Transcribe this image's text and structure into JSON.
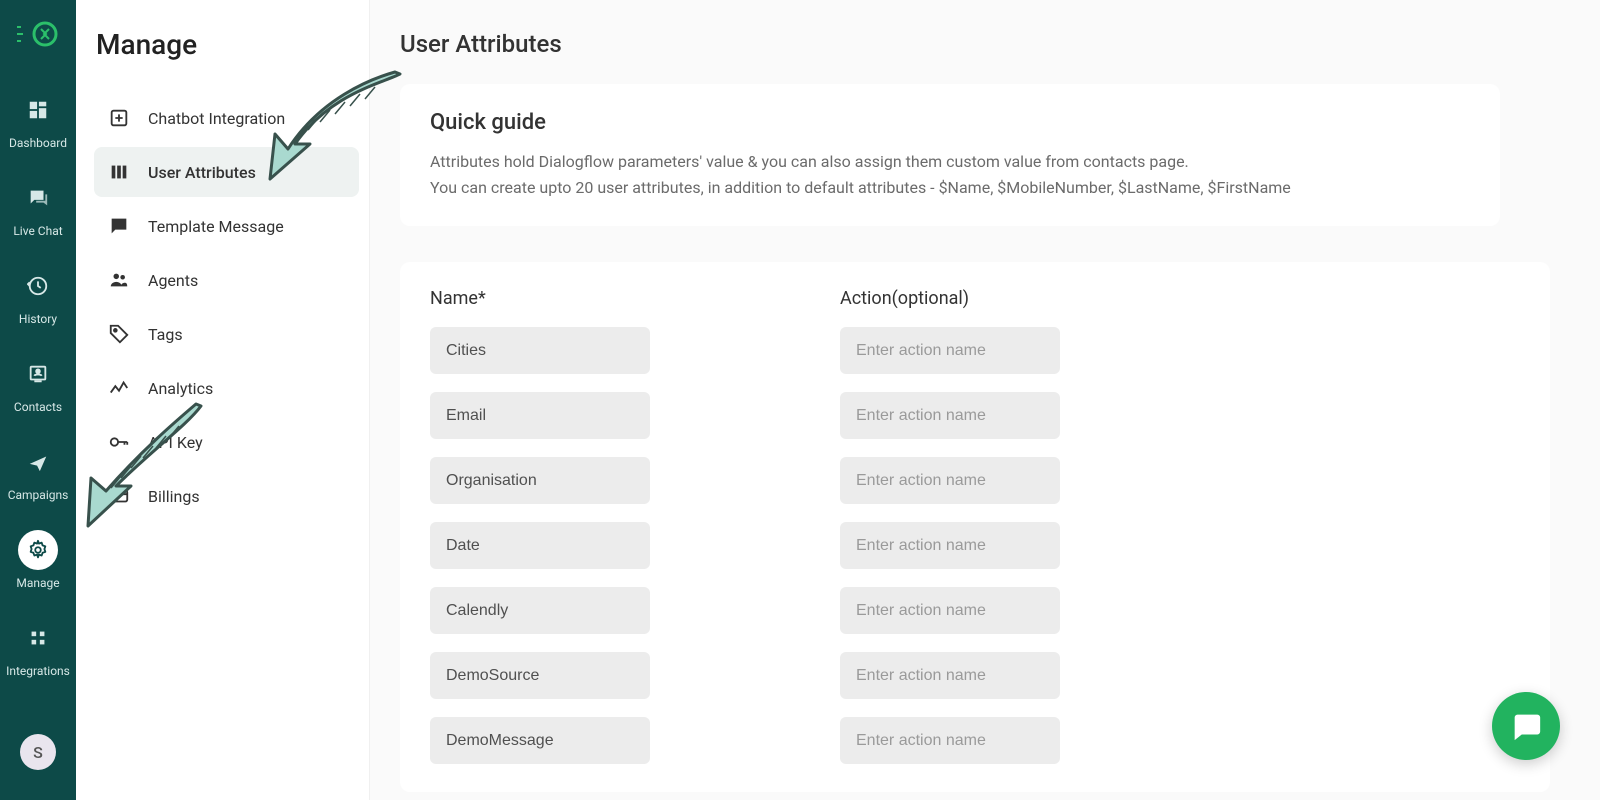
{
  "rail": {
    "items": [
      {
        "id": "dashboard",
        "label": "Dashboard"
      },
      {
        "id": "livechat",
        "label": "Live Chat"
      },
      {
        "id": "history",
        "label": "History"
      },
      {
        "id": "contacts",
        "label": "Contacts"
      },
      {
        "id": "campaigns",
        "label": "Campaigns"
      },
      {
        "id": "manage",
        "label": "Manage"
      },
      {
        "id": "integrations",
        "label": "Integrations"
      }
    ],
    "avatar_initial": "S"
  },
  "menu": {
    "title": "Manage",
    "items": [
      {
        "id": "chatbot-integration",
        "label": "Chatbot Integration"
      },
      {
        "id": "user-attributes",
        "label": "User Attributes"
      },
      {
        "id": "template-message",
        "label": "Template Message"
      },
      {
        "id": "agents",
        "label": "Agents"
      },
      {
        "id": "tags",
        "label": "Tags"
      },
      {
        "id": "analytics",
        "label": "Analytics"
      },
      {
        "id": "api-key",
        "label": "API Key"
      },
      {
        "id": "billings",
        "label": "Billings"
      }
    ]
  },
  "page": {
    "title": "User Attributes",
    "guide_title": "Quick guide",
    "guide_line1": "Attributes hold Dialogflow parameters' value & you can also assign them custom value from contacts page.",
    "guide_line2": "You can create upto 20 user attributes, in addition to default attributes - $Name, $MobileNumber, $LastName, $FirstName",
    "name_header": "Name*",
    "action_header": "Action(optional)",
    "action_placeholder": "Enter action name",
    "rows": [
      {
        "name": "Cities"
      },
      {
        "name": "Email"
      },
      {
        "name": "Organisation"
      },
      {
        "name": "Date"
      },
      {
        "name": "Calendly"
      },
      {
        "name": "DemoSource"
      },
      {
        "name": "DemoMessage"
      }
    ]
  },
  "colors": {
    "rail_bg": "#0d4a48",
    "accent_green": "#22b35f",
    "arrow_fill": "#a9d9cf"
  }
}
